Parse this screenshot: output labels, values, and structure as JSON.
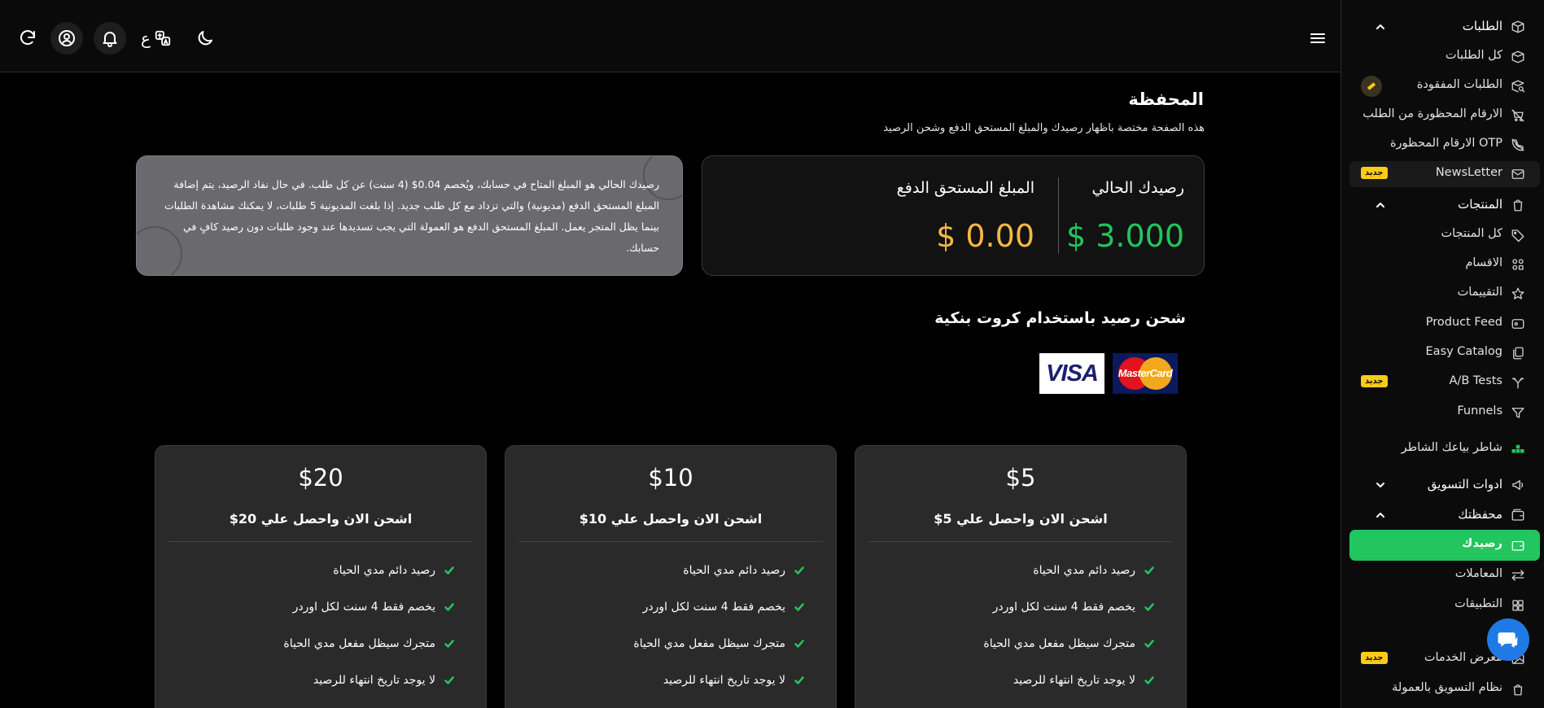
{
  "header": {
    "language_glyph": "ع"
  },
  "page": {
    "title": "المحفظة",
    "subtitle": "هذه الصفحة مختصة باظهار رصيدك والمبلغ المستحق الدفع وشحن الرصيد"
  },
  "balance": {
    "current_label": "رصيدك الحالي",
    "current_value": "$ 3.000",
    "current_color": "#22c55e",
    "due_label": "المبلغ المستحق الدفع",
    "due_value": "$ 0.00",
    "due_color": "#f5b942"
  },
  "info": {
    "text": "رصيدك الحالي هو المبلغ المتاح في حسابك، ويُخصم 0.04$ (4 سنت) عن كل طلب. في حال نفاد الرصيد، يتم إضافة المبلغ المستحق الدفع (مديونية) والتي تزداد مع كل طلب جديد. إذا بلغت المديونية 5 طلبات، لا يمكنك مشاهدة الطلبات بينما يظل المتجر يعمل. المبلغ المستحق الدفع هو العمولة التي يجب تسديدها عند وجود طلبات دون رصيد كافٍ في حسابك."
  },
  "topup": {
    "title": "شحن رصيد باستخدام كروت بنكية",
    "visa_label": "VISA",
    "mastercard_label": "MasterCard"
  },
  "plans": [
    {
      "price": "$5",
      "subtitle": "اشحن الان واحصل علي 5$",
      "features": [
        "رصيد دائم مدي الحياة",
        "يخصم فقط 4 سنت لكل اوردر",
        "متجرك سيظل مفعل مدي الحياة",
        "لا يوجد تاريخ انتهاء للرصيد"
      ]
    },
    {
      "price": "$10",
      "subtitle": "اشحن الان واحصل علي 10$",
      "features": [
        "رصيد دائم مدي الحياة",
        "يخصم فقط 4 سنت لكل اوردر",
        "متجرك سيظل مفعل مدي الحياة",
        "لا يوجد تاريخ انتهاء للرصيد"
      ]
    },
    {
      "price": "$20",
      "subtitle": "اشحن الان واحصل علي 20$",
      "features": [
        "رصيد دائم مدي الحياة",
        "يخصم فقط 4 سنت لكل اوردر",
        "متجرك سيظل مفعل مدي الحياة",
        "لا يوجد تاريخ انتهاء للرصيد"
      ]
    }
  ],
  "sidebar": {
    "new_badge": "جديد",
    "orders_section": "الطلبات",
    "all_orders": "كل الطلبات",
    "lost_orders": "الطلبات المفقودة",
    "banned_numbers_order": "الارقام المحظورة من الطلب",
    "banned_numbers_otp": "الارقام المحظورة OTP",
    "newsletter": "NewsLetter",
    "products_section": "المنتجات",
    "all_products": "كل المنتجات",
    "categories": "الاقسام",
    "reviews": "التقييمات",
    "product_feed": "Product Feed",
    "easy_catalog": "Easy Catalog",
    "ab_tests": "A/B Tests",
    "funnels": "Funnels",
    "shater": "شاطر بياعك الشاطر",
    "marketing_tools": "ادوات التسويق",
    "wallet_section": "محفظتك",
    "your_balance": "رصيدك",
    "transactions": "المعاملات",
    "apps": "التطبيقات",
    "services_gallery": "معرض الخدمات",
    "affiliate": "نظام التسويق بالعمولة"
  },
  "colors": {
    "accent": "#22c55e",
    "badge": "#facc15",
    "chat": "#1f7ae6"
  }
}
